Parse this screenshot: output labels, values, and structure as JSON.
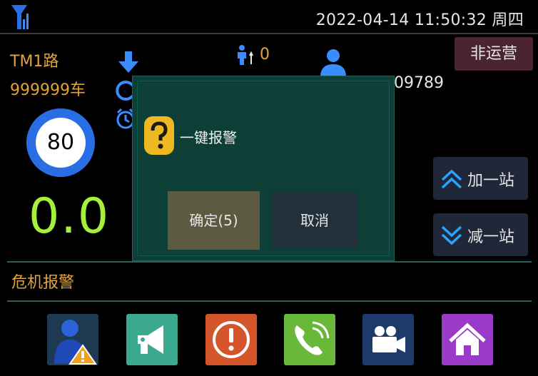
{
  "header": {
    "datetime": "2022-04-14 11:50:32 周四"
  },
  "info": {
    "route": "TM1路",
    "bus_no": "999999车",
    "speed_limit": "80",
    "speed": "0.0",
    "passenger_count": "0",
    "driver_id": "09789"
  },
  "status_button": "非运营",
  "station": {
    "add_label": "加一站",
    "sub_label": "减一站"
  },
  "alarm_label": "危机报警",
  "dialog": {
    "message": "一键报警",
    "ok_label": "确定(5)",
    "cancel_label": "取消"
  },
  "dock": [
    "driver-alert",
    "announcement",
    "emergency",
    "phone",
    "video",
    "home"
  ],
  "colors": {
    "accent_orange": "#e3a33a",
    "speed_green": "#a6f03a",
    "dialog_bg": "#0d3f36"
  }
}
